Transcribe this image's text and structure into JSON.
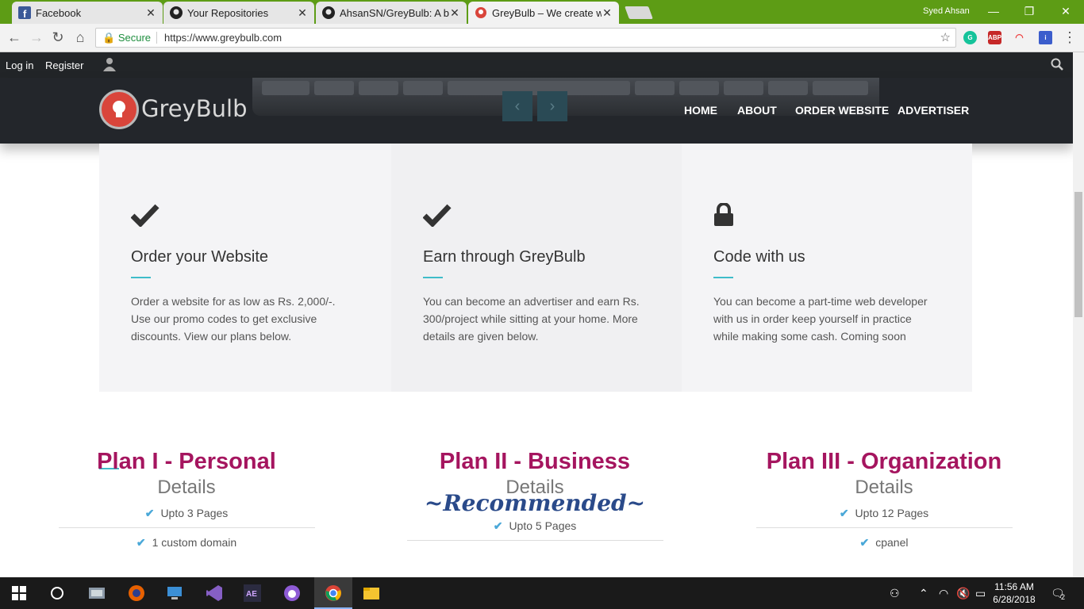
{
  "browser": {
    "tabs": [
      {
        "title": "Facebook"
      },
      {
        "title": "Your Repositories"
      },
      {
        "title": "AhsanSN/GreyBulb: A bu"
      },
      {
        "title": "GreyBulb – We create we"
      }
    ],
    "user": "Syed Ahsan",
    "secure_label": "Secure",
    "url": "https://www.greybulb.com"
  },
  "site": {
    "topbar": {
      "login": "Log in",
      "register": "Register"
    },
    "logo": "GreyBulb",
    "menu": [
      "HOME",
      "ABOUT",
      "ORDER WEBSITE",
      "ADVERTISER"
    ],
    "features": [
      {
        "icon": "check-icon",
        "title": "Order your Website",
        "text": "Order a website for as low as Rs. 2,000/-. Use our promo codes to get exclusive discounts. View our plans below."
      },
      {
        "icon": "check-icon",
        "title": "Earn through GreyBulb",
        "text": "You can become an advertiser and earn Rs. 300/project while sitting at your home. More details are given below."
      },
      {
        "icon": "lock-icon",
        "title": "Code with us",
        "text": "You can become a part-time web developer with us in order keep yourself in practice while making some cash. Coming soon"
      }
    ],
    "plans": [
      {
        "title": "Plan I - Personal",
        "details": "Details",
        "items": [
          "Upto 3 Pages",
          "1 custom domain"
        ]
      },
      {
        "title": "Plan II - Business",
        "details": "Details",
        "badge": "~Recommended~",
        "items": [
          "Upto 5 Pages"
        ]
      },
      {
        "title": "Plan III - Organization",
        "details": "Details",
        "items": [
          "Upto 12 Pages",
          "cpanel"
        ]
      }
    ],
    "colors": {
      "accent": "#3fbcc9",
      "plan_title": "#a5155f",
      "dark": "#23262b"
    }
  },
  "taskbar": {
    "time": "11:56 AM",
    "date": "6/28/2018",
    "notifications": "2"
  }
}
